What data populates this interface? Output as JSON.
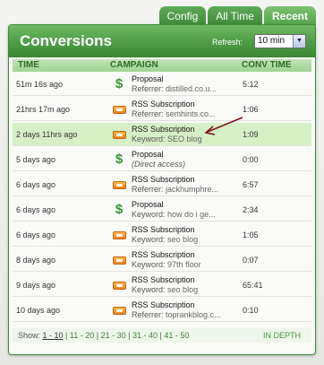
{
  "tabs": [
    {
      "label": "Config"
    },
    {
      "label": "All Time"
    },
    {
      "label": "Recent"
    }
  ],
  "widget": {
    "title": "Conversions",
    "refresh_label": "Refresh:",
    "refresh_value": "10 min"
  },
  "columns": {
    "time": "TIME",
    "campaign": "CAMPAIGN",
    "conv_time": "CONV TIME"
  },
  "rows": [
    {
      "time": "51m 16s ago",
      "icon": "dollar-icon",
      "name": "Proposal",
      "detail_label": "Referrer:",
      "detail_value": "distilled.co.u...",
      "conv": "5:12"
    },
    {
      "time": "21hrs 17m ago",
      "icon": "rss-icon",
      "name": "RSS Subscription",
      "detail_label": "Referrer:",
      "detail_value": "semhints.co...",
      "conv": "1:06"
    },
    {
      "time": "2 days 11hrs ago",
      "icon": "rss-icon",
      "name": "RSS Subscription",
      "detail_label": "Keyword:",
      "detail_value": "SEO blog",
      "conv": "1:09"
    },
    {
      "time": "5 days ago",
      "icon": "dollar-icon",
      "name": "Proposal",
      "detail_label": "(Direct access)",
      "detail_value": "",
      "conv": "0:00"
    },
    {
      "time": "6 days ago",
      "icon": "rss-icon",
      "name": "RSS Subscription",
      "detail_label": "Referrer:",
      "detail_value": "jackhumphre...",
      "conv": "6:57"
    },
    {
      "time": "6 days ago",
      "icon": "dollar-icon",
      "name": "Proposal",
      "detail_label": "Keyword:",
      "detail_value": "how do i ge...",
      "conv": "2:34"
    },
    {
      "time": "6 days ago",
      "icon": "rss-icon",
      "name": "RSS Subscription",
      "detail_label": "Keyword:",
      "detail_value": "seo blog",
      "conv": "1:05"
    },
    {
      "time": "8 days ago",
      "icon": "rss-icon",
      "name": "RSS Subscription",
      "detail_label": "Keyword:",
      "detail_value": "97th floor",
      "conv": "0:07"
    },
    {
      "time": "9 days ago",
      "icon": "rss-icon",
      "name": "RSS Subscription",
      "detail_label": "Keyword:",
      "detail_value": "seo blog",
      "conv": "65:41"
    },
    {
      "time": "10 days ago",
      "icon": "rss-icon",
      "name": "RSS Subscription",
      "detail_label": "Referrer:",
      "detail_value": "toprankblog.c...",
      "conv": "0:10"
    }
  ],
  "footer": {
    "show_label": "Show:",
    "pages": [
      "1 - 10",
      "11 - 20",
      "21 - 30",
      "31 - 40",
      "41 - 50"
    ],
    "in_depth": "IN DEPTH"
  },
  "colors": {
    "accent_green": "#4c9a44",
    "highlight_row": "#d6f0c6",
    "annotation_arrow": "#7a1010"
  }
}
